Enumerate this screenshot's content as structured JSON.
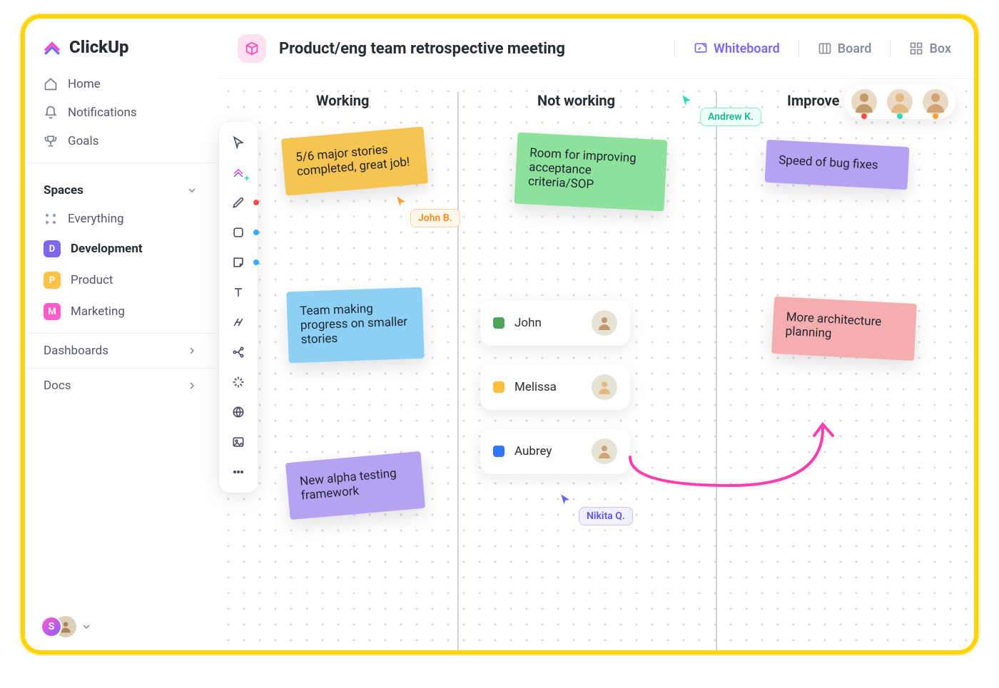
{
  "brand": "ClickUp",
  "sidebar": {
    "home": "Home",
    "notifications": "Notifications",
    "goals": "Goals",
    "spaces_header": "Spaces",
    "everything": "Everything",
    "spaces": [
      {
        "id": "D",
        "label": "Development",
        "color": "#7B68EE",
        "active": true
      },
      {
        "id": "P",
        "label": "Product",
        "color": "#FFC247",
        "active": false
      },
      {
        "id": "M",
        "label": "Marketing",
        "color": "#FF5CCB",
        "active": false
      }
    ],
    "dashboards": "Dashboards",
    "docs": "Docs",
    "profile_initial": "S"
  },
  "header": {
    "title": "Product/eng team retrospective meeting",
    "views": {
      "whiteboard": "Whiteboard",
      "board": "Board",
      "box": "Box"
    }
  },
  "canvas": {
    "columns": {
      "working": "Working",
      "not_working": "Not working",
      "improve": "Improve"
    },
    "stickies": {
      "s1": "5/6 major stories completed, great job!",
      "s2": "Team making progress on smaller stories",
      "s3": "New alpha testing framework",
      "s4": "Room for improving acceptance criteria/SOP",
      "s5": "Speed of bug fixes",
      "s6": "More architecture planning"
    },
    "people": {
      "p1": "John",
      "p2": "Melissa",
      "p3": "Aubrey"
    },
    "cursors": {
      "john": "John B.",
      "andrew": "Andrew K.",
      "nikita": "Nikita Q."
    },
    "presence_colors": [
      "#ff4d4d",
      "#2bd9b2",
      "#ff9f2e"
    ]
  },
  "colors": {
    "accent": "#7B68EE",
    "sticky_yellow": "#F6C451",
    "sticky_blue": "#8CD1F5",
    "sticky_purple": "#B6A2F2",
    "sticky_green": "#8CE29B",
    "sticky_pink": "#F5AEAE"
  }
}
